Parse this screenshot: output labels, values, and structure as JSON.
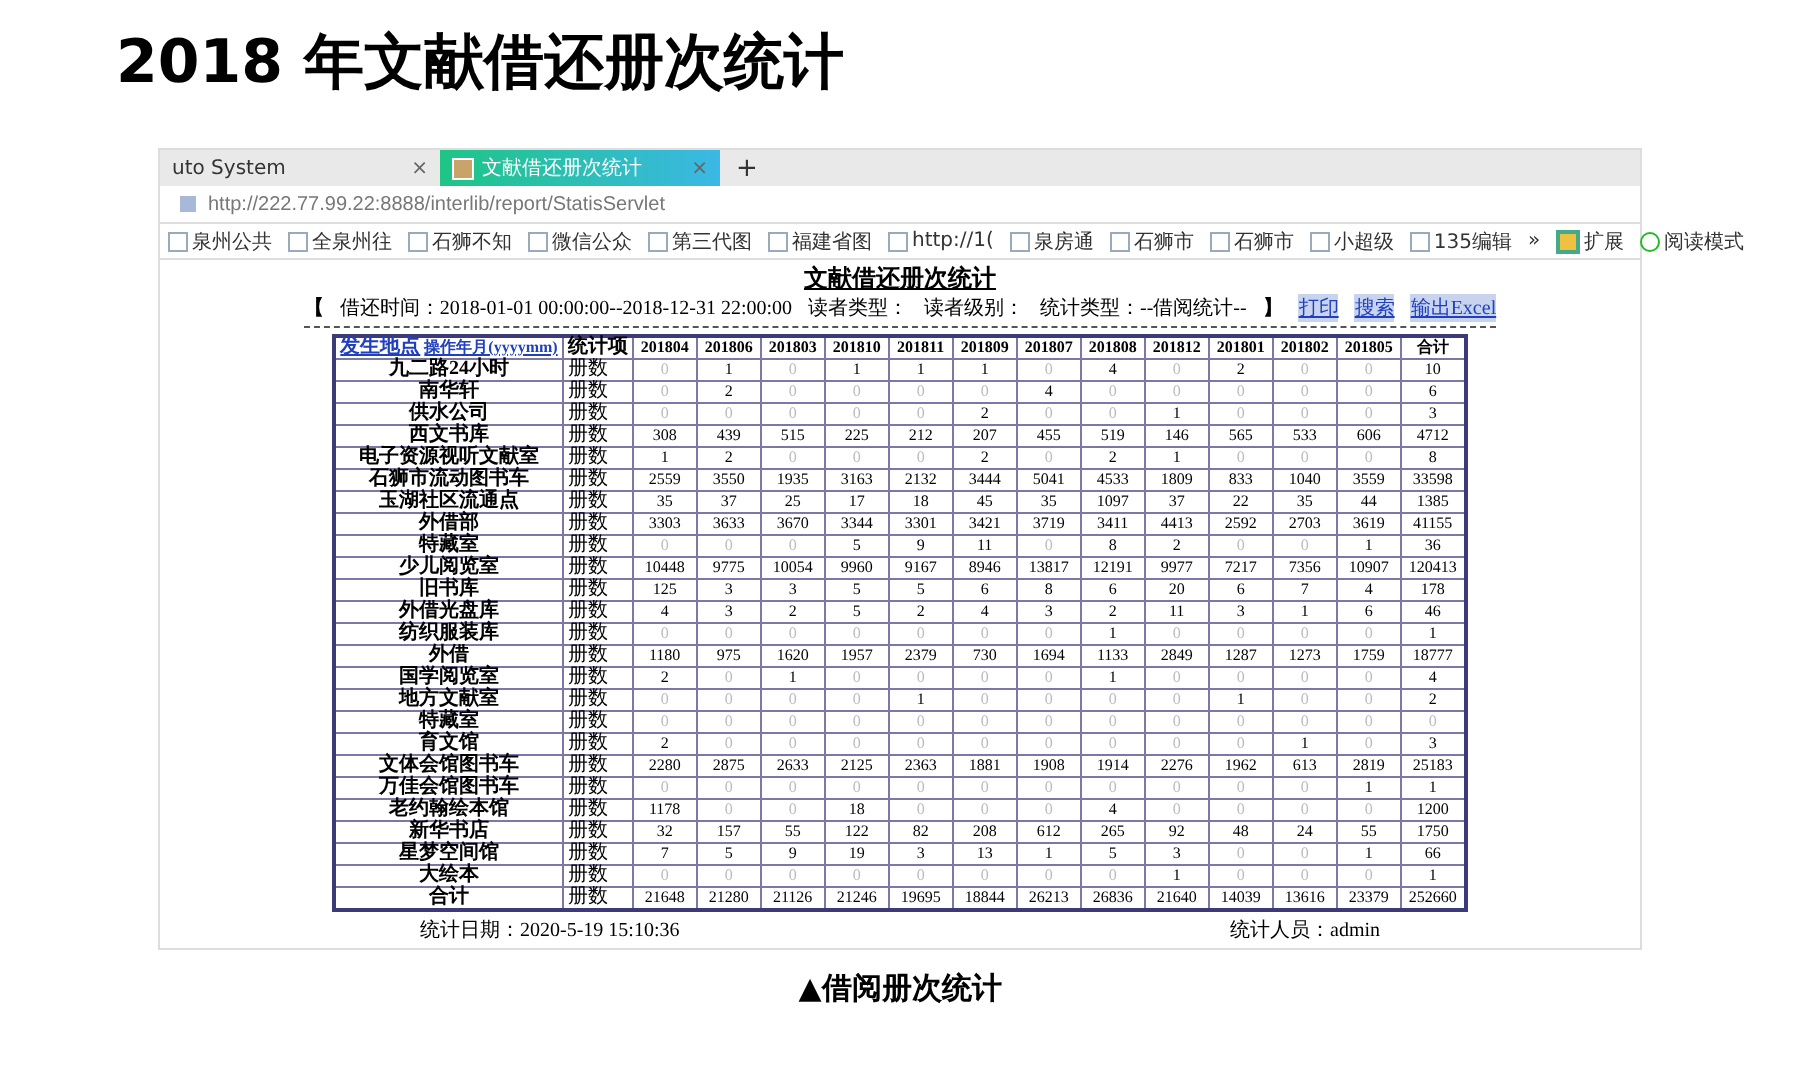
{
  "slide": {
    "title": "2018 年文献借还册次统计",
    "caption": "▲借阅册次统计"
  },
  "browser": {
    "tabs": [
      {
        "label": "uto System",
        "close": "×",
        "selected": false
      },
      {
        "label": "文献借还册次统计",
        "close": "×",
        "selected": true
      }
    ],
    "new_tab": "+",
    "url": "http://222.77.99.22:8888/interlib/report/StatisServlet",
    "bookmarks": [
      "泉州公共",
      "全泉州往",
      "石狮不知",
      "微信公众",
      "第三代图",
      "福建省图",
      "http://1(",
      "泉房通",
      "石狮市",
      "石狮市",
      "小超级",
      "135编辑"
    ],
    "bookmark_overflow": "»",
    "extensions": "扩展",
    "reading_mode": "阅读模式"
  },
  "report": {
    "title": "文献借还册次统计",
    "bracket_open": "【",
    "params": [
      "借还时间：2018-01-01 00:00:00--2018-12-31 22:00:00",
      "读者类型：",
      "读者级别：",
      "统计类型：--借阅统计--"
    ],
    "bracket_close": "】",
    "actions": [
      "打印",
      "搜索",
      "输出Excel"
    ],
    "header_links": [
      "发生地点",
      "操作年月(yyyymm)"
    ],
    "columns": [
      "统计项",
      "201804",
      "201806",
      "201803",
      "201810",
      "201811",
      "201809",
      "201807",
      "201808",
      "201812",
      "201801",
      "201802",
      "201805",
      "合计"
    ],
    "rows": [
      {
        "name": "九二路24小时",
        "item": "册数",
        "values": [
          "0",
          "1",
          "0",
          "1",
          "1",
          "1",
          "0",
          "4",
          "0",
          "2",
          "0",
          "0",
          "10"
        ]
      },
      {
        "name": "南华轩",
        "item": "册数",
        "values": [
          "0",
          "2",
          "0",
          "0",
          "0",
          "0",
          "4",
          "0",
          "0",
          "0",
          "0",
          "0",
          "6"
        ]
      },
      {
        "name": "供水公司",
        "item": "册数",
        "values": [
          "0",
          "0",
          "0",
          "0",
          "0",
          "2",
          "0",
          "0",
          "1",
          "0",
          "0",
          "0",
          "3"
        ]
      },
      {
        "name": "西文书库",
        "item": "册数",
        "values": [
          "308",
          "439",
          "515",
          "225",
          "212",
          "207",
          "455",
          "519",
          "146",
          "565",
          "533",
          "606",
          "4712"
        ]
      },
      {
        "name": "电子资源视听文献室",
        "item": "册数",
        "values": [
          "1",
          "2",
          "0",
          "0",
          "0",
          "2",
          "0",
          "2",
          "1",
          "0",
          "0",
          "0",
          "8"
        ]
      },
      {
        "name": "石狮市流动图书车",
        "item": "册数",
        "values": [
          "2559",
          "3550",
          "1935",
          "3163",
          "2132",
          "3444",
          "5041",
          "4533",
          "1809",
          "833",
          "1040",
          "3559",
          "33598"
        ]
      },
      {
        "name": "玉湖社区流通点",
        "item": "册数",
        "values": [
          "35",
          "37",
          "25",
          "17",
          "18",
          "45",
          "35",
          "1097",
          "37",
          "22",
          "35",
          "44",
          "1385"
        ]
      },
      {
        "name": "外借部",
        "item": "册数",
        "values": [
          "3303",
          "3633",
          "3670",
          "3344",
          "3301",
          "3421",
          "3719",
          "3411",
          "4413",
          "2592",
          "2703",
          "3619",
          "41155"
        ]
      },
      {
        "name": "特藏室",
        "item": "册数",
        "values": [
          "0",
          "0",
          "0",
          "5",
          "9",
          "11",
          "0",
          "8",
          "2",
          "0",
          "0",
          "1",
          "36"
        ]
      },
      {
        "name": "少儿阅览室",
        "item": "册数",
        "values": [
          "10448",
          "9775",
          "10054",
          "9960",
          "9167",
          "8946",
          "13817",
          "12191",
          "9977",
          "7217",
          "7356",
          "10907",
          "120413"
        ]
      },
      {
        "name": "旧书库",
        "item": "册数",
        "values": [
          "125",
          "3",
          "3",
          "5",
          "5",
          "6",
          "8",
          "6",
          "20",
          "6",
          "7",
          "4",
          "178"
        ]
      },
      {
        "name": "外借光盘库",
        "item": "册数",
        "values": [
          "4",
          "3",
          "2",
          "5",
          "2",
          "4",
          "3",
          "2",
          "11",
          "3",
          "1",
          "6",
          "46"
        ]
      },
      {
        "name": "纺织服装库",
        "item": "册数",
        "values": [
          "0",
          "0",
          "0",
          "0",
          "0",
          "0",
          "0",
          "1",
          "0",
          "0",
          "0",
          "0",
          "1"
        ]
      },
      {
        "name": "外借",
        "item": "册数",
        "values": [
          "1180",
          "975",
          "1620",
          "1957",
          "2379",
          "730",
          "1694",
          "1133",
          "2849",
          "1287",
          "1273",
          "1759",
          "18777"
        ]
      },
      {
        "name": "国学阅览室",
        "item": "册数",
        "values": [
          "2",
          "0",
          "1",
          "0",
          "0",
          "0",
          "0",
          "1",
          "0",
          "0",
          "0",
          "0",
          "4"
        ]
      },
      {
        "name": "地方文献室",
        "item": "册数",
        "values": [
          "0",
          "0",
          "0",
          "0",
          "1",
          "0",
          "0",
          "0",
          "0",
          "1",
          "0",
          "0",
          "2"
        ]
      },
      {
        "name": "特藏室",
        "item": "册数",
        "values": [
          "0",
          "0",
          "0",
          "0",
          "0",
          "0",
          "0",
          "0",
          "0",
          "0",
          "0",
          "0",
          "0"
        ]
      },
      {
        "name": "育文馆",
        "item": "册数",
        "values": [
          "2",
          "0",
          "0",
          "0",
          "0",
          "0",
          "0",
          "0",
          "0",
          "0",
          "1",
          "0",
          "3"
        ]
      },
      {
        "name": "文体会馆图书车",
        "item": "册数",
        "values": [
          "2280",
          "2875",
          "2633",
          "2125",
          "2363",
          "1881",
          "1908",
          "1914",
          "2276",
          "1962",
          "613",
          "2819",
          "25183"
        ]
      },
      {
        "name": "万佳会馆图书车",
        "item": "册数",
        "values": [
          "0",
          "0",
          "0",
          "0",
          "0",
          "0",
          "0",
          "0",
          "0",
          "0",
          "0",
          "1",
          "1"
        ]
      },
      {
        "name": "老约翰绘本馆",
        "item": "册数",
        "values": [
          "1178",
          "0",
          "0",
          "18",
          "0",
          "0",
          "0",
          "4",
          "0",
          "0",
          "0",
          "0",
          "1200"
        ]
      },
      {
        "name": "新华书店",
        "item": "册数",
        "values": [
          "32",
          "157",
          "55",
          "122",
          "82",
          "208",
          "612",
          "265",
          "92",
          "48",
          "24",
          "55",
          "1750"
        ]
      },
      {
        "name": "星梦空间馆",
        "item": "册数",
        "values": [
          "7",
          "5",
          "9",
          "19",
          "3",
          "13",
          "1",
          "5",
          "3",
          "0",
          "0",
          "1",
          "66"
        ]
      },
      {
        "name": "大绘本",
        "item": "册数",
        "values": [
          "0",
          "0",
          "0",
          "0",
          "0",
          "0",
          "0",
          "0",
          "1",
          "0",
          "0",
          "0",
          "1"
        ]
      },
      {
        "name": "合计",
        "item": "册数",
        "values": [
          "21648",
          "21280",
          "21126",
          "21246",
          "19695",
          "18844",
          "26213",
          "26836",
          "21640",
          "14039",
          "13616",
          "23379",
          "252660"
        ]
      }
    ],
    "date": "统计日期：2020-5-19 15:10:36",
    "user": "统计人员：admin"
  }
}
